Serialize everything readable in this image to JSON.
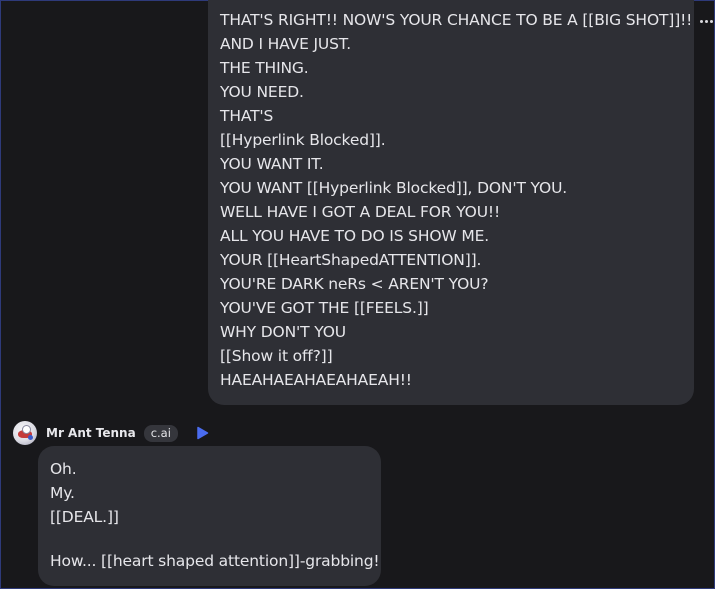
{
  "user_message": {
    "lines": [
      "THAT'S RIGHT!! NOW'S YOUR CHANCE TO BE A [[BIG SHOT]]!!",
      "AND I HAVE JUST.",
      "THE THING.",
      "YOU NEED.",
      "THAT'S",
      "[[Hyperlink Blocked]].",
      "YOU WANT IT.",
      "YOU WANT [[Hyperlink Blocked]], DON'T YOU.",
      "WELL HAVE I GOT A DEAL FOR YOU!!",
      "ALL YOU HAVE TO DO IS SHOW ME.",
      "YOUR [[HeartShapedATTENTION]].",
      "YOU'RE DARK neRs < AREN'T YOU?",
      "YOU'VE GOT THE [[FEELS.]]",
      "WHY DON'T YOU",
      "[[Show it off?]]",
      "HAEAHAEAHAEAHAEAH!!"
    ]
  },
  "bot": {
    "name": "Mr Ant Tenna",
    "badge": "c.ai",
    "message_lines": [
      "Oh.",
      "My.",
      "[[DEAL.]]"
    ],
    "message_last": "How... [[heart shaped attention]]-grabbing!"
  },
  "icons": {
    "more": "more-options-icon",
    "play": "play-icon",
    "avatar": "avatar-image"
  },
  "colors": {
    "background": "#18181b",
    "bubble": "#2e2f35",
    "text": "#e6e6ea",
    "play_accent": "#4a6cf0",
    "badge_bg": "#35363c"
  }
}
